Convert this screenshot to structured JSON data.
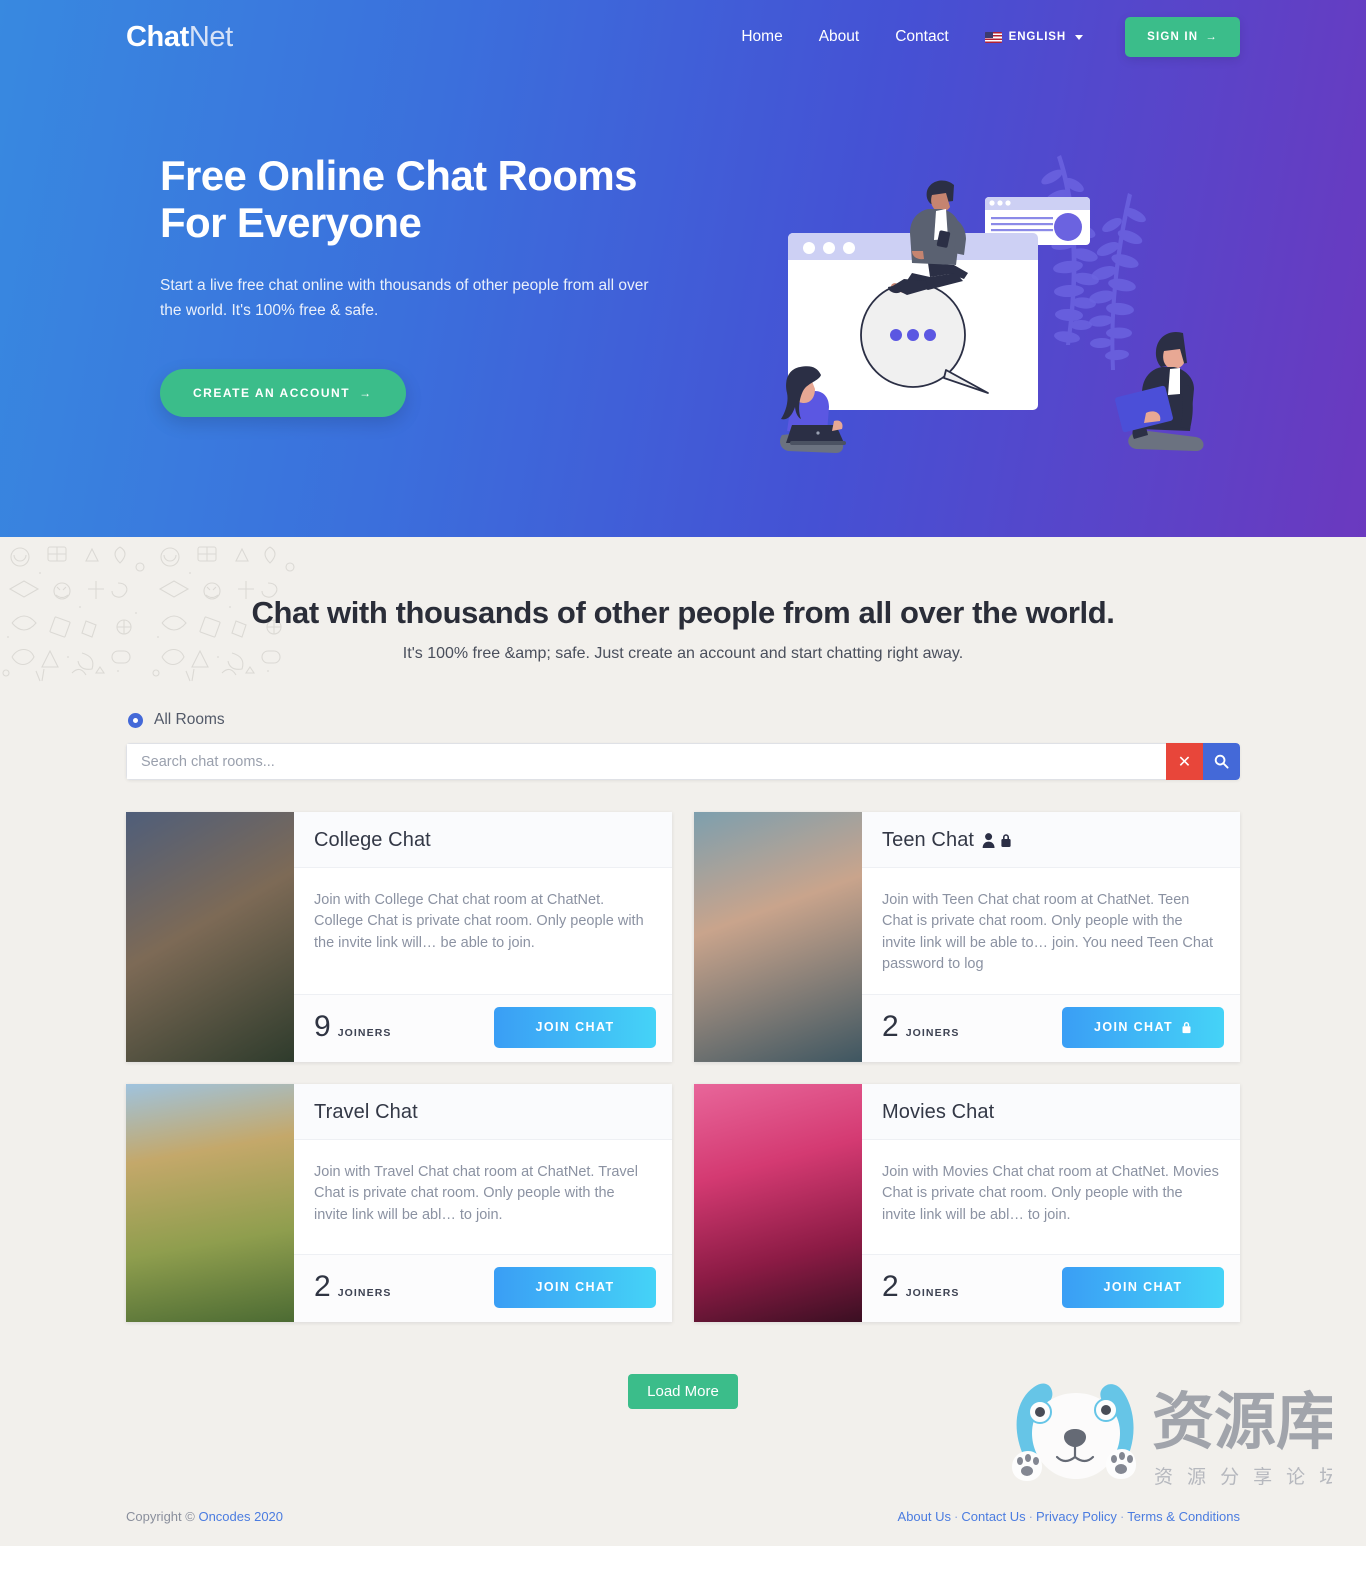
{
  "brand": {
    "bold": "Chat",
    "light": "Net"
  },
  "nav": {
    "links": [
      {
        "label": "Home"
      },
      {
        "label": "About"
      },
      {
        "label": "Contact"
      }
    ],
    "language": "ENGLISH",
    "signin_label": "SIGN IN",
    "signin_arrow": "→",
    "flag_icon": "us-flag-icon",
    "caret_icon": "chevron-down-icon"
  },
  "hero": {
    "title_line1": "Free Online Chat Rooms",
    "title_line2": "For Everyone",
    "subtitle": "Start a live free chat online with thousands of other people from all over the world. It's 100% free & safe.",
    "cta_label": "CREATE AN ACCOUNT",
    "cta_arrow": "→",
    "gradient_from": "#3889e0",
    "gradient_to": "#6b39bf"
  },
  "rooms": {
    "heading": "Chat with thousands of other people from all over the world.",
    "subheading": "It's 100% free &amp; safe. Just create an account and start chatting right away.",
    "filter_label": "All Rooms",
    "search_placeholder": "Search chat rooms...",
    "search_value": "",
    "clear_icon": "close-icon",
    "clear_glyph": "✕",
    "search_icon": "search-icon",
    "load_more_label": "Load More",
    "accent_blue": "#4469d8",
    "clear_red": "#e8463a",
    "join_gradient_from": "#3a9ef5",
    "join_gradient_to": "#45d3f7",
    "cards": [
      {
        "title": "College Chat",
        "private": false,
        "locked": false,
        "description": "Join with College Chat chat room at ChatNet. College Chat is private chat room. Only people with the invite link will… be able to join.",
        "joiners": "9",
        "joiners_label": "JOINERS",
        "join_label": "JOIN CHAT",
        "thumb": "classroom-students-photo"
      },
      {
        "title": "Teen Chat",
        "private": true,
        "locked": true,
        "description": "Join with Teen Chat chat room at ChatNet. Teen Chat is private chat room. Only people with the invite link will be able to… join. You need Teen Chat password to log",
        "joiners": "2",
        "joiners_label": "JOINERS",
        "join_label": "JOIN CHAT",
        "thumb": "smiling-friends-photo"
      },
      {
        "title": "Travel Chat",
        "private": false,
        "locked": false,
        "description": "Join with Travel Chat chat room at ChatNet. Travel Chat is private chat room. Only people with the invite link will be abl… to join.",
        "joiners": "2",
        "joiners_label": "JOINERS",
        "join_label": "JOIN CHAT",
        "thumb": "rice-terrace-landscape-photo"
      },
      {
        "title": "Movies Chat",
        "private": false,
        "locked": false,
        "description": "Join with Movies Chat chat room at ChatNet. Movies Chat is private chat room. Only people with the invite link will be abl… to join.",
        "joiners": "2",
        "joiners_label": "JOINERS",
        "join_label": "JOIN CHAT",
        "thumb": "cinema-entrance-photo"
      }
    ]
  },
  "watermark": {
    "logo_text": "资源库",
    "tagline": "资 源 分 享 论 坛",
    "mascot": "bear-mascot-icon",
    "color": "#5bc2e7"
  },
  "footer": {
    "copyright_prefix": "Copyright © ",
    "copyright_link": "Oncodes 2020",
    "links": [
      {
        "label": "About Us"
      },
      {
        "label": "Contact Us"
      },
      {
        "label": "Privacy Policy"
      },
      {
        "label": "Terms & Conditions"
      }
    ],
    "separator": "·"
  }
}
